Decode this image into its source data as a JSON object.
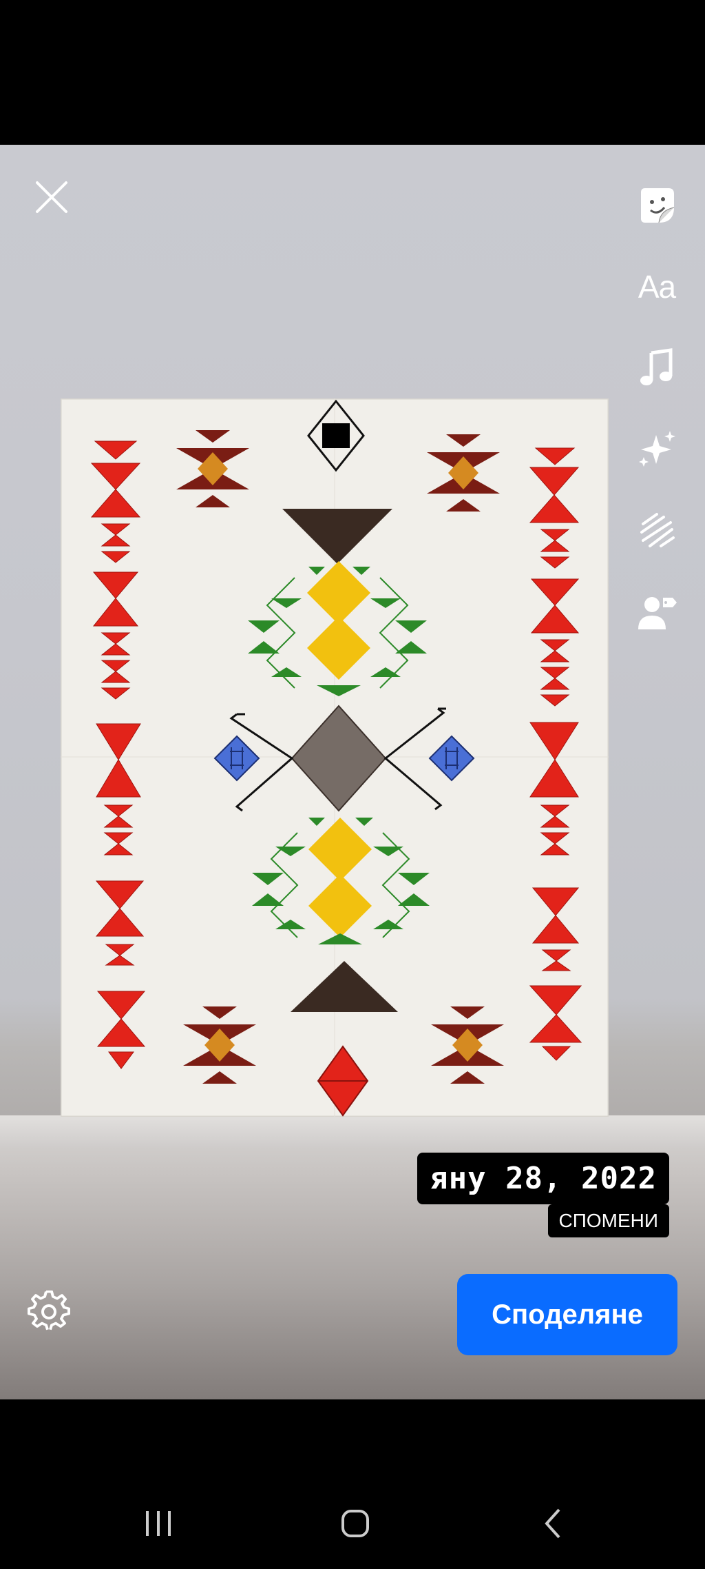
{
  "toolbar": {
    "close_icon": "close-icon",
    "tools": [
      {
        "name": "sticker-icon"
      },
      {
        "name": "text-tool",
        "label": "Aa"
      },
      {
        "name": "music-icon"
      },
      {
        "name": "effects-icon"
      },
      {
        "name": "scribble-icon"
      },
      {
        "name": "tag-people-icon"
      }
    ]
  },
  "memory": {
    "date": "яну 28, 2022",
    "label": "СПОМЕНИ"
  },
  "footer": {
    "settings_icon": "gear-icon",
    "share_label": "Споделяне"
  },
  "colors": {
    "share_button": "#0a6cff"
  }
}
